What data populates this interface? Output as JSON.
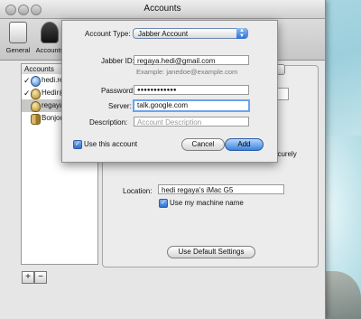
{
  "window": {
    "title": "Accounts",
    "toolbar": [
      {
        "label": "General",
        "icon": "switch-icon"
      },
      {
        "label": "Accounts",
        "icon": "person-icon"
      }
    ]
  },
  "accounts_list": {
    "header": "Accounts",
    "items": [
      {
        "label": "hedi.re",
        "checked": true,
        "icon": "globe-icon"
      },
      {
        "label": "Hedir@",
        "checked": true,
        "icon": "bulb-icon"
      },
      {
        "label": "regaya",
        "checked": false,
        "icon": "bulb-icon"
      },
      {
        "label": "Bonjou",
        "checked": false,
        "icon": "bonjour-icon"
      }
    ],
    "add": "+",
    "remove": "−"
  },
  "details_panel": {
    "partial_text": "ecurely",
    "location_label": "Location:",
    "location_value": "hedi regaya's iMac G5",
    "use_machine_name_label": "Use my machine name",
    "default_settings_button": "Use Default Settings"
  },
  "sheet": {
    "account_type_label": "Account Type:",
    "account_type_value": "Jabber Account",
    "jabber_id_label": "Jabber ID:",
    "jabber_id_value": "regaya.hedi@gmail.com",
    "example_text": "Example: janedoe@example.com",
    "password_label": "Password:",
    "password_value": "●●●●●●●●●●●●",
    "server_label": "Server:",
    "server_value": "talk.google.com",
    "description_label": "Description:",
    "description_placeholder": "Account Description",
    "use_account_label": "Use this account",
    "cancel_button": "Cancel",
    "add_button": "Add"
  },
  "colors": {
    "accent": "#3b82dc"
  }
}
